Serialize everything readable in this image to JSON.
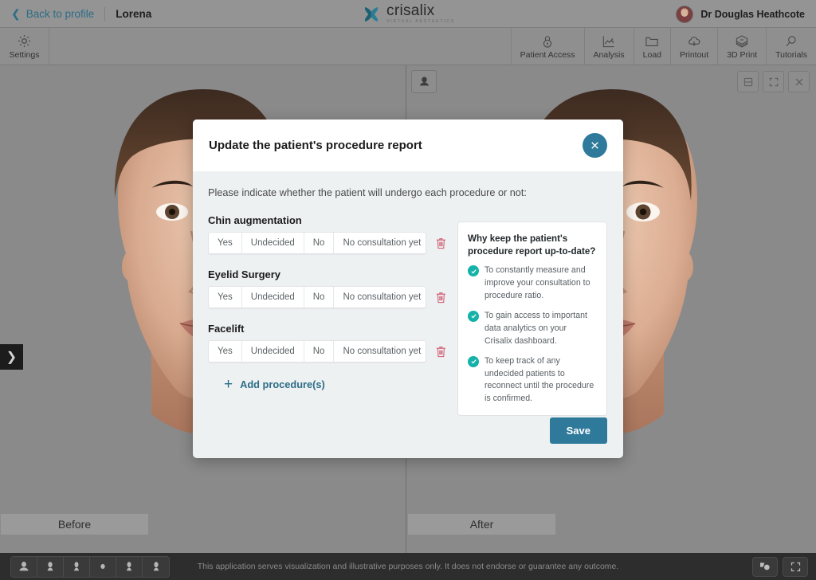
{
  "header": {
    "back_label": "Back to profile",
    "patient_name": "Lorena",
    "logo_word": "crisalix",
    "logo_sub": "VIRTUAL AESTHETICS",
    "user_name": "Dr Douglas Heathcote"
  },
  "toolbar": {
    "settings": "Settings",
    "items": [
      {
        "label": "Patient Access",
        "icon": "lock-icon"
      },
      {
        "label": "Analysis",
        "icon": "chart-trend-icon"
      },
      {
        "label": "Load",
        "icon": "folder-icon"
      },
      {
        "label": "Printout",
        "icon": "cloud-download-icon"
      },
      {
        "label": "3D Print",
        "icon": "cube-layers-icon"
      },
      {
        "label": "Tutorials",
        "icon": "magnifier-icon"
      }
    ]
  },
  "viewer": {
    "before_label": "Before",
    "after_label": "After",
    "camera_icon": "portrait-camera-icon",
    "panel_toggle_icon": "chevron-right-icon",
    "controls": [
      {
        "icon": "save-disk-icon"
      },
      {
        "icon": "expand-icon"
      },
      {
        "icon": "close-icon"
      }
    ]
  },
  "bottom": {
    "angle_icons": [
      "face-front-icon",
      "face-three-quarter-left-icon",
      "face-profile-left-icon",
      "face-top-icon",
      "face-profile-right-icon",
      "face-three-quarter-right-icon"
    ],
    "disclaimer": "This application serves visualization and illustrative purposes only. It does not endorse or guarantee any outcome.",
    "right_icons": [
      "compare-shapes-icon",
      "fullscreen-icon"
    ]
  },
  "modal": {
    "title": "Update the patient's procedure report",
    "close_icon": "close-icon",
    "subtitle": "Please indicate whether the patient will undergo each procedure or not:",
    "segment_options": [
      "Yes",
      "Undecided",
      "No",
      "No consultation yet"
    ],
    "procedures": [
      {
        "name": "Chin augmentation",
        "delete_icon": "trash-icon"
      },
      {
        "name": "Eyelid Surgery",
        "delete_icon": "trash-icon"
      },
      {
        "name": "Facelift",
        "delete_icon": "trash-icon"
      }
    ],
    "add_label": "Add procedure(s)",
    "add_icon": "plus-icon",
    "info": {
      "title": "Why keep the patient's procedure report up-to-date?",
      "items": [
        "To constantly measure and improve your consultation to procedure ratio.",
        "To gain access to important data analytics on your Crisalix dashboard.",
        "To keep track of any undecided patients to reconnect until the procedure is confirmed."
      ]
    },
    "save_label": "Save"
  },
  "colors": {
    "accent": "#2f7a9b",
    "link": "#2c6d86",
    "check": "#16b1a8",
    "danger": "#cf5870",
    "modal_bg": "#eef1f2"
  }
}
